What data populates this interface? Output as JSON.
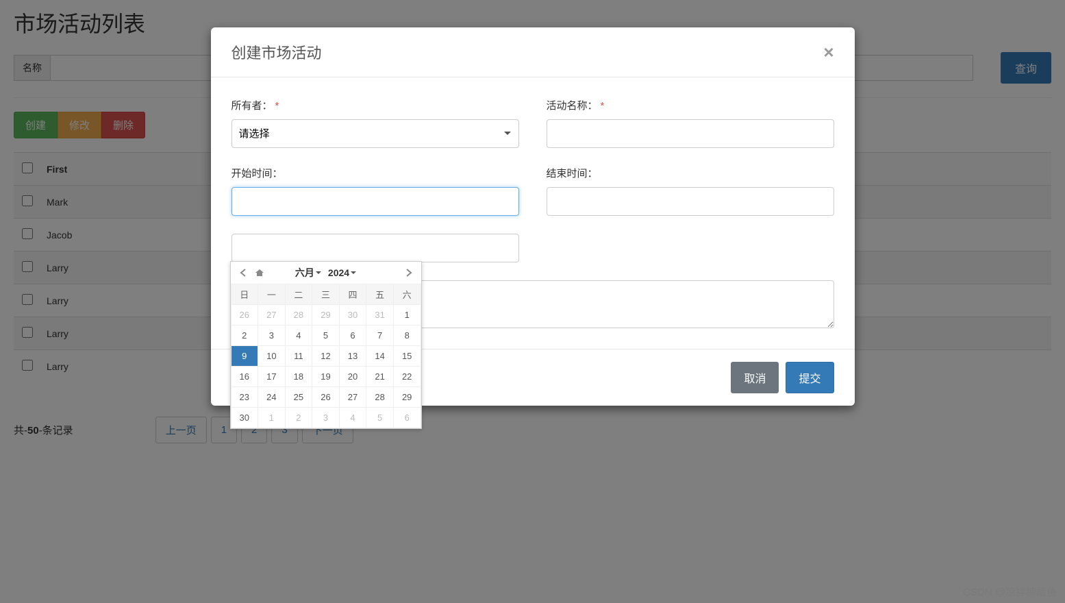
{
  "page": {
    "title": "市场活动列表",
    "search_label": "名称",
    "query_button": "查询"
  },
  "toolbar": {
    "create": "创建",
    "edit": "修改",
    "delete": "删除"
  },
  "table": {
    "headers": {
      "first": "First"
    },
    "rows": [
      {
        "first": "Mark"
      },
      {
        "first": "Jacob"
      },
      {
        "first": "Larry"
      },
      {
        "first": "Larry"
      },
      {
        "first": "Larry"
      },
      {
        "first": "Larry"
      }
    ]
  },
  "footer": {
    "prefix": "共-",
    "total": "50",
    "suffix": "-条记录"
  },
  "pager": {
    "prev": "上一页",
    "pages": [
      "1",
      "2",
      "3"
    ],
    "next": "下一页"
  },
  "modal": {
    "title": "创建市场活动",
    "owner_label": "所有者：",
    "owner_placeholder": "请选择",
    "activity_name_label": "活动名称：",
    "start_time_label": "开始时间：",
    "end_time_label": "结束时间：",
    "cancel": "取消",
    "submit": "提交"
  },
  "datepicker": {
    "month": "六月",
    "year": "2024",
    "weekdays": [
      "日",
      "一",
      "二",
      "三",
      "四",
      "五",
      "六"
    ],
    "grid": [
      [
        {
          "d": "26",
          "o": true
        },
        {
          "d": "27",
          "o": true
        },
        {
          "d": "28",
          "o": true
        },
        {
          "d": "29",
          "o": true
        },
        {
          "d": "30",
          "o": true
        },
        {
          "d": "31",
          "o": true
        },
        {
          "d": "1"
        }
      ],
      [
        {
          "d": "2"
        },
        {
          "d": "3"
        },
        {
          "d": "4"
        },
        {
          "d": "5"
        },
        {
          "d": "6"
        },
        {
          "d": "7"
        },
        {
          "d": "8"
        }
      ],
      [
        {
          "d": "9",
          "sel": true
        },
        {
          "d": "10"
        },
        {
          "d": "11"
        },
        {
          "d": "12"
        },
        {
          "d": "13"
        },
        {
          "d": "14"
        },
        {
          "d": "15"
        }
      ],
      [
        {
          "d": "16"
        },
        {
          "d": "17"
        },
        {
          "d": "18"
        },
        {
          "d": "19"
        },
        {
          "d": "20"
        },
        {
          "d": "21"
        },
        {
          "d": "22"
        }
      ],
      [
        {
          "d": "23"
        },
        {
          "d": "24"
        },
        {
          "d": "25"
        },
        {
          "d": "26"
        },
        {
          "d": "27"
        },
        {
          "d": "28"
        },
        {
          "d": "29"
        }
      ],
      [
        {
          "d": "30"
        },
        {
          "d": "1",
          "o": true
        },
        {
          "d": "2",
          "o": true
        },
        {
          "d": "3",
          "o": true
        },
        {
          "d": "4",
          "o": true
        },
        {
          "d": "5",
          "o": true
        },
        {
          "d": "6",
          "o": true
        }
      ]
    ]
  },
  "watermark": "CSDN @凉拌糖醋鱼"
}
